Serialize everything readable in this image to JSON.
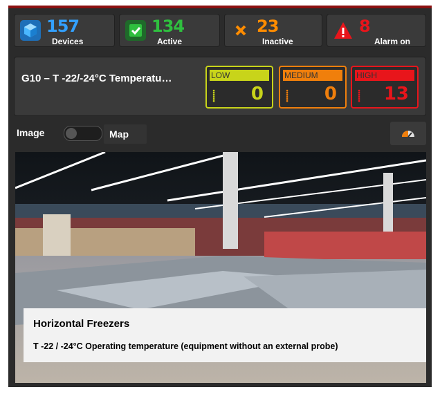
{
  "stats": [
    {
      "value": "157",
      "label": "Devices",
      "color": "#33a0ff",
      "icon": "cube-icon"
    },
    {
      "value": "134",
      "label": "Active",
      "color": "#2fbf3f",
      "icon": "checkbox-icon"
    },
    {
      "value": "23",
      "label": "Inactive",
      "color": "#ff8c00",
      "icon": "x-icon"
    },
    {
      "value": "8",
      "label": "Alarm on",
      "color": "#e8151b",
      "icon": "warning-icon"
    }
  ],
  "device": {
    "title": "G10 – T -22/-24°C Temperatu…"
  },
  "levels": [
    {
      "label": "LOW",
      "count": "0",
      "color": "#c8d41a"
    },
    {
      "label": "MEDIUM",
      "count": "0",
      "color": "#f07f0c"
    },
    {
      "label": "HIGH",
      "count": "13",
      "color": "#e8151b"
    }
  ],
  "view_toggle": {
    "left_label": "Image",
    "right_label": "Map"
  },
  "caption": {
    "title": "Horizontal Freezers",
    "subtitle": "T -22 / -24°C Operating temperature (equipment without an external probe)"
  }
}
